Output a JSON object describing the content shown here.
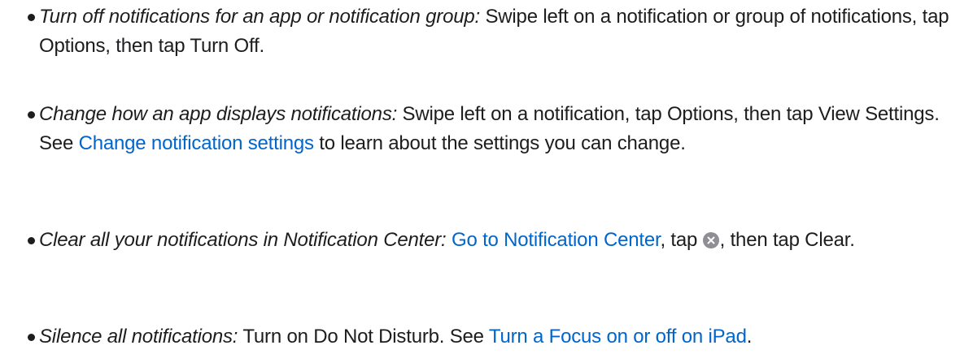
{
  "items": [
    {
      "lead": "Turn off notifications for an app or notification group:",
      "text": " Swipe left on a notification or group of notifications, tap Options, then tap Turn Off."
    },
    {
      "lead": "Change how an app displays notifications:",
      "text_before": " Swipe left on a notification, tap Options, then tap View Settings. See ",
      "link": "Change notification settings",
      "text_after": " to learn about the settings you can change."
    },
    {
      "lead": "Clear all your notifications in Notification Center:",
      "text_before": " ",
      "link": "Go to Notification Center",
      "text_middle": ", tap ",
      "icon": "clear-x-icon",
      "text_after": ", then tap Clear."
    },
    {
      "lead": "Silence all notifications:",
      "text_before": " Turn on Do Not Disturb. See ",
      "link": "Turn a Focus on or off on iPad",
      "text_after": "."
    }
  ],
  "colors": {
    "text": "#1d1d1f",
    "link": "#0066cc",
    "icon_bg": "#8e8e93"
  }
}
